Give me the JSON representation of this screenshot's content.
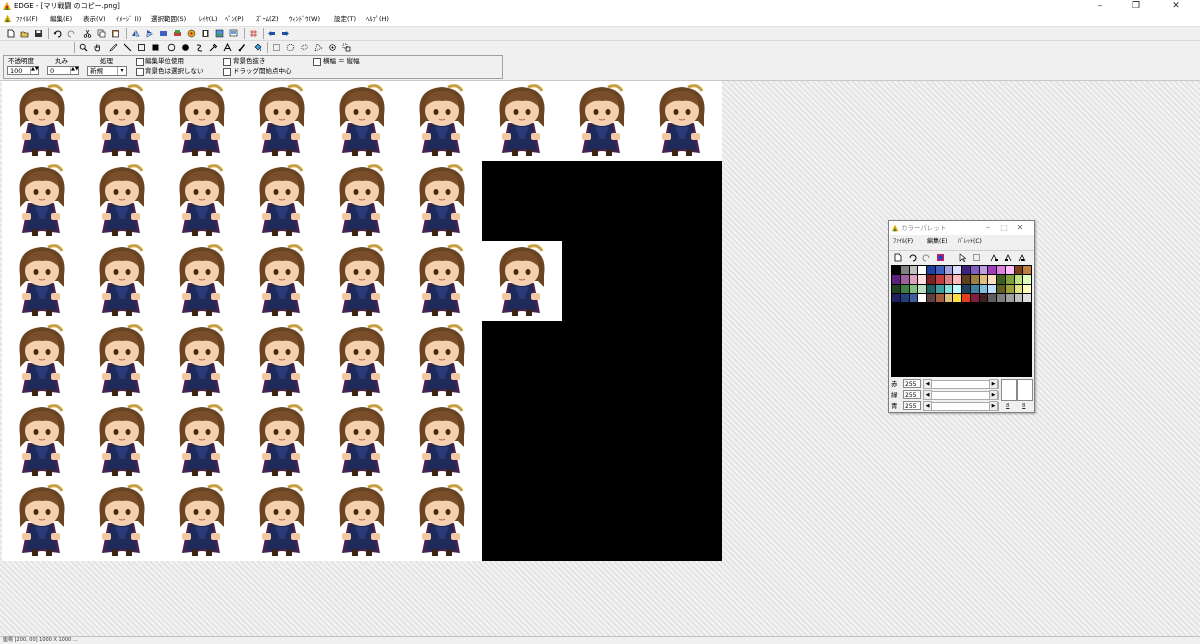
{
  "window": {
    "title": "EDGE - [マリ戦闘 のコピー.png]"
  },
  "menu": {
    "items": [
      "ﾌｧｲﾙ(F)",
      "編集(E)",
      "表示(V)",
      "ｲﾒｰｼﾞ (I)",
      "選択範囲(S)",
      "ﾚｲﾔ(L)",
      "ﾍﾟﾝ(P)",
      "ｽﾞｰﾑ(Z)",
      "ｳｨﾝﾄﾞｳ(W)",
      "設定(T)",
      "ﾍﾙﾌﾟ(H)"
    ]
  },
  "options": {
    "opacity_label": "不透明度",
    "opacity_value": "100",
    "round_label": "丸み",
    "round_value": "0",
    "process_label": "処理",
    "process_value": "新規",
    "edit_unit_label": "編集単位使用",
    "bg_no_select_label": "背景色は選択しない",
    "bg_transparent_label": "背景色抜き",
    "drag_start_center_label": "ドラッグ開始点中心",
    "width_eq_height_label": "横幅 ＝ 縦幅"
  },
  "palette": {
    "title": "カラーパレット",
    "menu": [
      "ﾌｧｲﾙ(F)",
      "編集(E)",
      "ﾊﾟﾚｯﾄ(C)"
    ],
    "red_label": "赤",
    "red_value": "255",
    "green_label": "緑",
    "green_value": "255",
    "blue_label": "青",
    "blue_value": "255",
    "small_a": "8",
    "small_b": "8",
    "colors": [
      "#000000",
      "#808080",
      "#c0c0c0",
      "#ffffff",
      "#1f3f9f",
      "#3f5fbf",
      "#9f9fdf",
      "#dfdfff",
      "#3f1f7f",
      "#7f5fbf",
      "#bf9fdf",
      "#9f3fbf",
      "#df7fdf",
      "#ffbfff",
      "#7f3f1f",
      "#bf7f3f",
      "#5f1f7f",
      "#9f5f9f",
      "#df9fbf",
      "#ffdfdf",
      "#7f1f1f",
      "#bf3f3f",
      "#df7f7f",
      "#ffbfbf",
      "#5f3f1f",
      "#9f7f3f",
      "#dfbf7f",
      "#ffdfbf",
      "#3f5f1f",
      "#7f9f3f",
      "#bfdf7f",
      "#dfffbf",
      "#1f3f1f",
      "#3f7f3f",
      "#7fbf7f",
      "#bfdfbf",
      "#1f5f5f",
      "#3f9f9f",
      "#7fdfdf",
      "#bfffff",
      "#1f3f5f",
      "#3f7f9f",
      "#7fbfdf",
      "#bfdfff",
      "#5f5f1f",
      "#9f9f3f",
      "#dfdf7f",
      "#ffffbf",
      "#1f1f5f",
      "#1f3f7f",
      "#3f5f9f",
      "#ffffff",
      "#5f3f3f",
      "#9f5f3f",
      "#dfbf7f",
      "#ffdf3f",
      "#df3f1f",
      "#7f1f3f",
      "#3f1f1f",
      "#5f5f5f",
      "#7f7f7f",
      "#9f9f9f",
      "#bfbfbf",
      "#dfdfdf"
    ]
  },
  "status": {
    "text": "座標 [200, 00]   1000 X 1000   ..."
  }
}
